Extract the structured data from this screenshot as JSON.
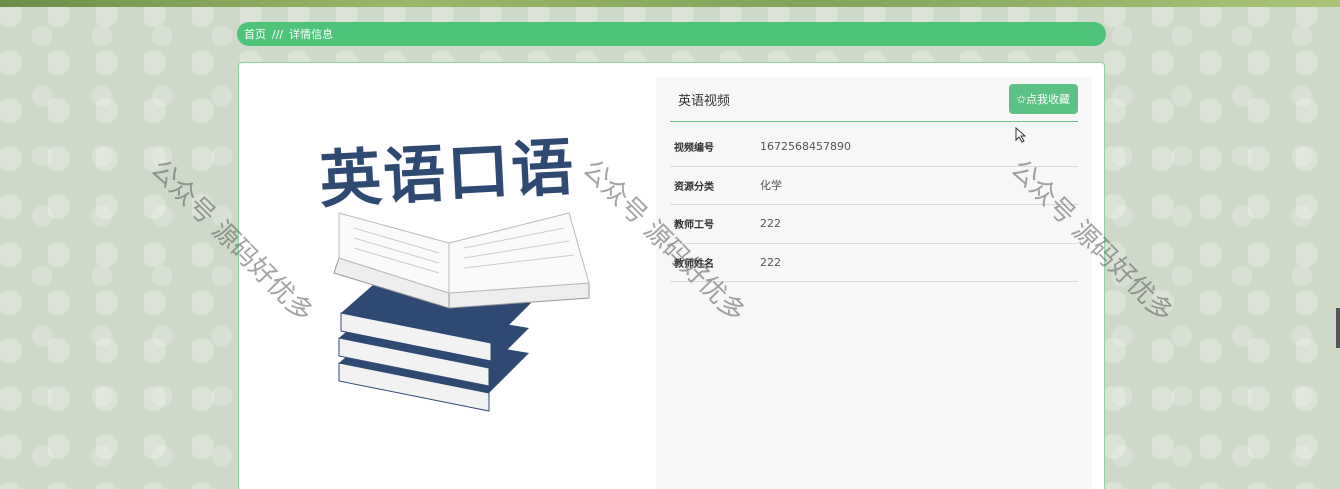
{
  "breadcrumb": {
    "home": "首页",
    "separator": "///",
    "current": "详情信息"
  },
  "detail": {
    "title": "英语视频",
    "favorite_button": "✩点我收藏",
    "cover_title": "英语口语",
    "fields": [
      {
        "label": "视频编号",
        "value": "1672568457890"
      },
      {
        "label": "资源分类",
        "value": "化学"
      },
      {
        "label": "教师工号",
        "value": "222"
      },
      {
        "label": "教师姓名",
        "value": "222"
      }
    ]
  },
  "watermark": "公众号 源码好优多",
  "colors": {
    "accent": "#4ec479",
    "button": "#5cc184",
    "book_blue": "#2f4a72"
  }
}
